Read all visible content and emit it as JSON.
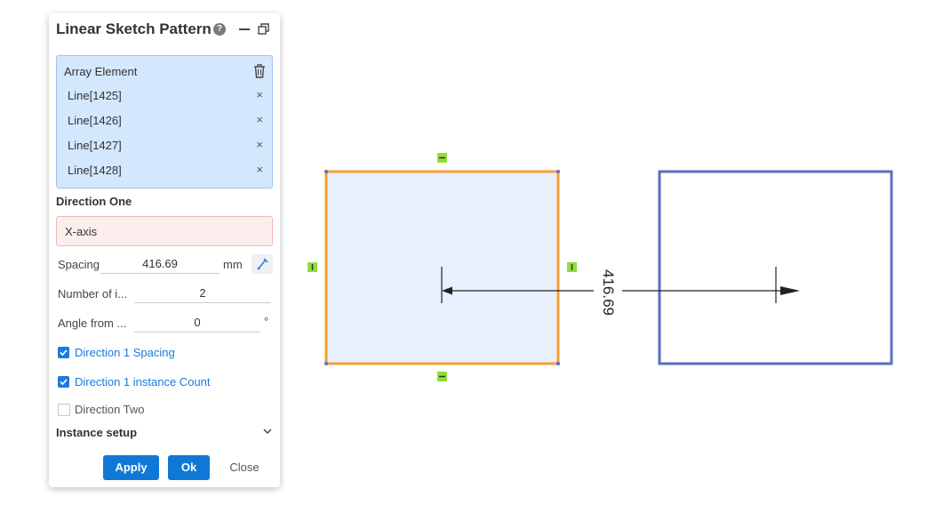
{
  "panel": {
    "title": "Linear Sketch Pattern",
    "help": "?",
    "array": {
      "title": "Array Element",
      "items": [
        "Line[1425]",
        "Line[1426]",
        "Line[1427]",
        "Line[1428]"
      ],
      "remove_glyph": "×"
    },
    "direction_one": {
      "heading": "Direction One",
      "axis": "X-axis",
      "spacing_label": "Spacing",
      "spacing_value": "416.69",
      "spacing_unit": "mm",
      "count_label": "Number of i...",
      "count_value": "2",
      "angle_label": "Angle from ...",
      "angle_value": "0",
      "angle_unit": "°"
    },
    "checks": {
      "spacing": "Direction 1 Spacing",
      "count": "Direction 1 instance Count",
      "dir_two": "Direction Two"
    },
    "instance_setup": "Instance setup",
    "buttons": {
      "apply": "Apply",
      "ok": "Ok",
      "close": "Close"
    }
  },
  "canvas": {
    "dimension_text": "416.69"
  },
  "colors": {
    "accent": "#0f78d7",
    "selected_edge": "#f5a033",
    "pattern_edge": "#5a6ec3",
    "constraint": "#8ede3d"
  }
}
